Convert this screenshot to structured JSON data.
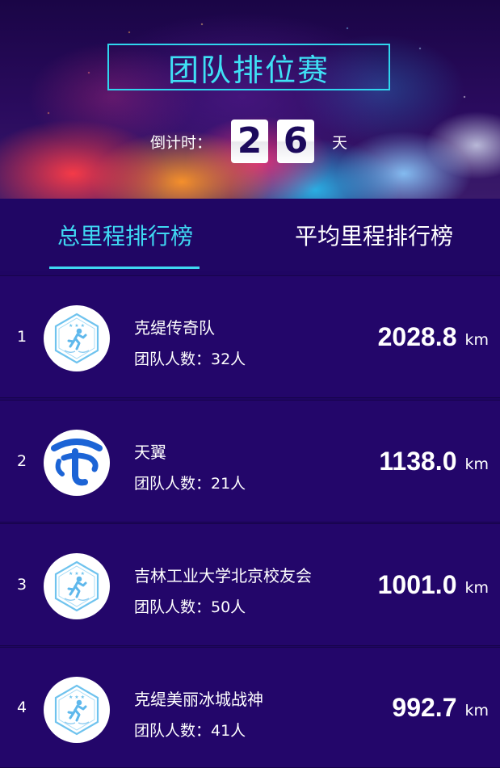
{
  "header": {
    "title": "团队排位赛",
    "countdown_label": "倒计时：",
    "countdown_digits": [
      "2",
      "6"
    ],
    "countdown_unit": "天"
  },
  "tabs": [
    {
      "label": "总里程排行榜",
      "active": true
    },
    {
      "label": "平均里程排行榜",
      "active": false
    }
  ],
  "colors": {
    "accent": "#3fd8f2",
    "background": "#1f0563",
    "row_background": "#23066a"
  },
  "teams": [
    {
      "rank": "1",
      "name": "克缇传奇队",
      "members": "团队人数：32人",
      "distance": "2028.8",
      "unit": "km",
      "avatar_icon": "runner-badge-icon"
    },
    {
      "rank": "2",
      "name": "天翼",
      "members": "团队人数：21人",
      "distance": "1138.0",
      "unit": "km",
      "avatar_icon": "china-telecom-logo-icon"
    },
    {
      "rank": "3",
      "name": "吉林工业大学北京校友会",
      "members": "团队人数：50人",
      "distance": "1001.0",
      "unit": "km",
      "avatar_icon": "runner-badge-icon"
    },
    {
      "rank": "4",
      "name": "克缇美丽冰城战神",
      "members": "团队人数：41人",
      "distance": "992.7",
      "unit": "km",
      "avatar_icon": "runner-badge-icon"
    }
  ]
}
